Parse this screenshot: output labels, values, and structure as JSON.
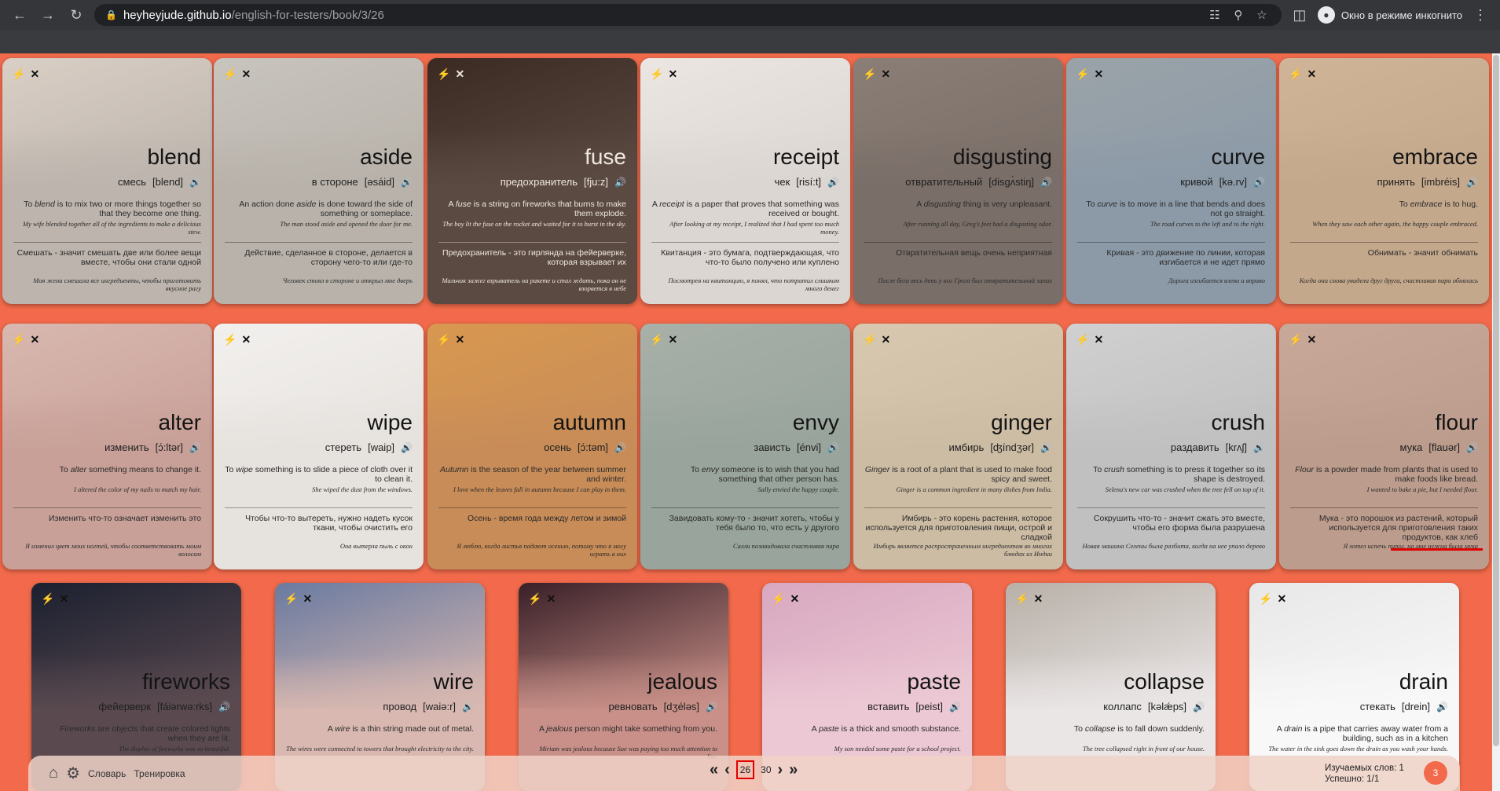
{
  "browser": {
    "host": "heyheyjude.github.io",
    "path": "/english-for-testers/book/3/26",
    "incognito_label": "Окно в режиме инкогнито"
  },
  "cards": [
    {
      "word": "blend",
      "translation": "смесь",
      "ipa": "[blend]",
      "definition_pre": "To ",
      "definition_em": "blend",
      "definition_post": " is to mix two or more things together so that they become one thing.",
      "example": "My wife blended together all of the ingredients to make a delicious stew.",
      "ru": "Смешать - значит смешать две или более вещи вместе, чтобы они стали одной",
      "ru_example": "Моя жена смешала все ингредиенты, чтобы приготовить вкусное рагу",
      "colors": [
        "#d9cfc5",
        "#bdb4ad"
      ],
      "dark": false
    },
    {
      "word": "aside",
      "translation": "в стороне",
      "ipa": "[əsáid]",
      "definition_pre": "An action done ",
      "definition_em": "aside",
      "definition_post": " is done toward the side of something or someplace.",
      "example": "The man stood aside and opened the door for me.",
      "ru": "Действие, сделанное в стороне, делается в сторону чего-то или где-то",
      "ru_example": "Человек стоял в стороне и открыл мне дверь",
      "colors": [
        "#c8c4be",
        "#b8b2aa"
      ],
      "dark": false
    },
    {
      "word": "fuse",
      "translation": "предохранитель",
      "ipa": "[fju:z]",
      "definition_pre": "A ",
      "definition_em": "fuse",
      "definition_post": " is a string on fireworks that burns to make them explode.",
      "example": "The boy lit the fuse on the rocket and waited for it to burst in the sky.",
      "ru": "Предохранитель - это гирлянда на фейерверке, которая взрывает их",
      "ru_example": "Мальчик зажег взрыватель на ракете и стал ждать, пока он не взорвется в небе",
      "colors": [
        "#3a2a22",
        "#5b4a42"
      ],
      "dark": true
    },
    {
      "word": "receipt",
      "translation": "чек",
      "ipa": "[risí:t]",
      "definition_pre": "A ",
      "definition_em": "receipt",
      "definition_post": " is a paper that proves that something was received or bought.",
      "example": "After looking at my receipt, I realized that I had spent too much money.",
      "ru": "Квитанция - это бумага, подтверждающая, что что-то было получено или куплено",
      "ru_example": "Посмотрев на квитанцию, я понял, что потратил слишком много денег",
      "colors": [
        "#ece6e2",
        "#dcd6d2"
      ],
      "dark": false
    },
    {
      "word": "disgusting",
      "translation": "отвратительный",
      "ipa": "[disgʌ́stiŋ]",
      "definition_pre": "A ",
      "definition_em": "disgusting",
      "definition_post": " thing is very unpleasant.",
      "example": "After running all day, Greg's feet had a disgusting odor.",
      "ru": "Отвратительная вещь очень неприятная",
      "ru_example": "После бега весь день у ног Грега был отвратительный запах",
      "colors": [
        "#8a7e76",
        "#7a6e68"
      ],
      "dark": false
    },
    {
      "word": "curve",
      "translation": "кривой",
      "ipa": "[kə.rv]",
      "definition_pre": "To ",
      "definition_em": "curve",
      "definition_post": " is to move in a line that bends and does not go straight.",
      "example": "The road curves to the left and to the right.",
      "ru": "Кривая - это движение по линии, которая изгибается и не идет прямо",
      "ru_example": "Дорога изгибается влево и вправо",
      "colors": [
        "#9aa3a8",
        "#8c9aa8"
      ],
      "dark": false
    },
    {
      "word": "embrace",
      "translation": "принять",
      "ipa": "[imbréis]",
      "definition_pre": "To ",
      "definition_em": "embrace",
      "definition_post": " is to hug.",
      "example": "When they saw each other again, the happy couple embraced.",
      "ru": "Обнимать - значит обнимать",
      "ru_example": "Когда они снова увидели друг друга, счастливая пара обнялась",
      "colors": [
        "#d0b498",
        "#c4a88c"
      ],
      "dark": false
    },
    {
      "word": "alter",
      "translation": "изменить",
      "ipa": "[ɔ́:ltər]",
      "definition_pre": "To ",
      "definition_em": "alter",
      "definition_post": " something means to change it.",
      "example": "I altered the color of my nails to match my hair.",
      "ru": "Изменить что-то означает изменить это",
      "ru_example": "Я изменил цвет моих ногтей, чтобы соответствовать моим волосам",
      "colors": [
        "#d8b8b0",
        "#c8a098"
      ],
      "dark": false
    },
    {
      "word": "wipe",
      "translation": "стереть",
      "ipa": "[waip]",
      "definition_pre": "To ",
      "definition_em": "wipe",
      "definition_post": " something is to slide a piece of cloth over it to clean it.",
      "example": "She wiped the dust from the windows.",
      "ru": "Чтобы что-то вытереть, нужно надеть кусок ткани, чтобы очистить его",
      "ru_example": "Она вытерла пыль с окон",
      "colors": [
        "#f2f0ee",
        "#e6e2de"
      ],
      "dark": false
    },
    {
      "word": "autumn",
      "translation": "осень",
      "ipa": "[ɔ́:təm]",
      "definition_pre": "",
      "definition_em": "Autumn",
      "definition_post": " is the season of the year between summer and winter.",
      "example": "I love when the leaves fall in autumn because I can play in them.",
      "ru": "Осень - время года между летом и зимой",
      "ru_example": "Я люблю, когда листья падают осенью, потому что я могу играть в них",
      "colors": [
        "#d89850",
        "#c88c58"
      ],
      "dark": false
    },
    {
      "word": "envy",
      "translation": "зависть",
      "ipa": "[énvi]",
      "definition_pre": "To ",
      "definition_em": "envy",
      "definition_post": " someone is to wish that you had something that other person has.",
      "example": "Sally envied the happy couple.",
      "ru": "Завидовать кому-то - значит хотеть, чтобы у тебя было то, что есть у другого",
      "ru_example": "Салли позавидовала счастливая пара",
      "colors": [
        "#a8b0a8",
        "#98a49c"
      ],
      "dark": false
    },
    {
      "word": "ginger",
      "translation": "имбирь",
      "ipa": "[ʤíndʒər]",
      "definition_pre": "",
      "definition_em": "Ginger",
      "definition_post": " is a root of a plant that is used to make food spicy and sweet.",
      "example": "Ginger is a common ingredient in many dishes from India.",
      "ru": "Имбирь - это корень растения, которое используется для приготовления пищи, острой и сладкой",
      "ru_example": "Имбирь является распространенным ингредиентом во многих блюдах из Индии",
      "colors": [
        "#d8c8b0",
        "#ccbca4"
      ],
      "dark": false
    },
    {
      "word": "crush",
      "translation": "раздавить",
      "ipa": "[krʌʃ]",
      "definition_pre": "To ",
      "definition_em": "crush",
      "definition_post": " something is to press it together so its shape is destroyed.",
      "example": "Selena's new car was crushed when the tree fell on top of it.",
      "ru": "Сокрушить что-то - значит сжать это вместе, чтобы его форма была разрушена",
      "ru_example": "Новая машина Селены была разбита, когда на нее упало дерево",
      "colors": [
        "#d0d0d0",
        "#c0c0c0"
      ],
      "dark": false
    },
    {
      "word": "flour",
      "translation": "мука",
      "ipa": "[flauər]",
      "definition_pre": "",
      "definition_em": "Flour",
      "definition_post": " is a powder made from plants that is used to make foods like bread.",
      "example": "I wanted to bake a pie, but I needed flour.",
      "ru": "Мука - это порошок из растений, который используется для приготовления таких продуктов, как хлеб",
      "ru_example": "Я хотел испечь пирог, но мне нужна была мука",
      "colors": [
        "#c8a898",
        "#bc9c8c"
      ],
      "dark": false
    },
    {
      "word": "fireworks",
      "translation": "фейерверк",
      "ipa": "[fáiərwə:rks]",
      "definition_pre": "",
      "definition_em": "Fireworks",
      "definition_post": " are objects that create colored lights when they are lit.",
      "example": "The display of fireworks was so beautiful.",
      "ru": "",
      "ru_example": "",
      "colors": [
        "#1c2030",
        "#5a4a50"
      ],
      "dark": false
    },
    {
      "word": "wire",
      "translation": "провод",
      "ipa": "[waiə:r]",
      "definition_pre": "A ",
      "definition_em": "wire",
      "definition_post": " is a thin string made out of metal.",
      "example": "The wires were connected to towers that brought electricity to the city.",
      "ru": "",
      "ru_example": "",
      "colors": [
        "#6a7aa0",
        "#d8b8b0"
      ],
      "dark": false
    },
    {
      "word": "jealous",
      "translation": "ревновать",
      "ipa": "[dʒéləs]",
      "definition_pre": "A ",
      "definition_em": "jealous",
      "definition_post": " person might take something from you.",
      "example": "Miriam was jealous because Sue was paying too much attention to Jim.",
      "ru": "",
      "ru_example": "",
      "colors": [
        "#3a2028",
        "#c89088"
      ],
      "dark": false
    },
    {
      "word": "paste",
      "translation": "вставить",
      "ipa": "[peist]",
      "definition_pre": "A ",
      "definition_em": "paste",
      "definition_post": " is a thick and smooth substance.",
      "example": "My son needed some paste for a school project.",
      "ru": "",
      "ru_example": "",
      "colors": [
        "#d8a8c0",
        "#ecc8d4"
      ],
      "dark": false
    },
    {
      "word": "collapse",
      "translation": "коллапс",
      "ipa": "[kəlǽps]",
      "definition_pre": "To ",
      "definition_em": "collapse",
      "definition_post": " is to fall down suddenly.",
      "example": "The tree collapsed right in front of our house.",
      "ru": "",
      "ru_example": "",
      "colors": [
        "#b8b0a8",
        "#eae6e6"
      ],
      "dark": false
    },
    {
      "word": "drain",
      "translation": "стекать",
      "ipa": "[drein]",
      "definition_pre": "A ",
      "definition_em": "drain",
      "definition_post": " is a pipe that carries away water from a building, such as in a kitchen",
      "example": "The water in the sink goes down the drain as you wash your hands.",
      "ru": "",
      "ru_example": "",
      "colors": [
        "#e8e8e8",
        "#f8f8f8"
      ],
      "dark": false
    }
  ],
  "bottom_bar": {
    "dictionary_label": "Словарь",
    "training_label": "Тренировка",
    "current_page": "26",
    "total_pages": "30",
    "studied_label": "Изучаемых слов: 1",
    "success_label": "Успешно: 1/1",
    "badge": "3"
  }
}
